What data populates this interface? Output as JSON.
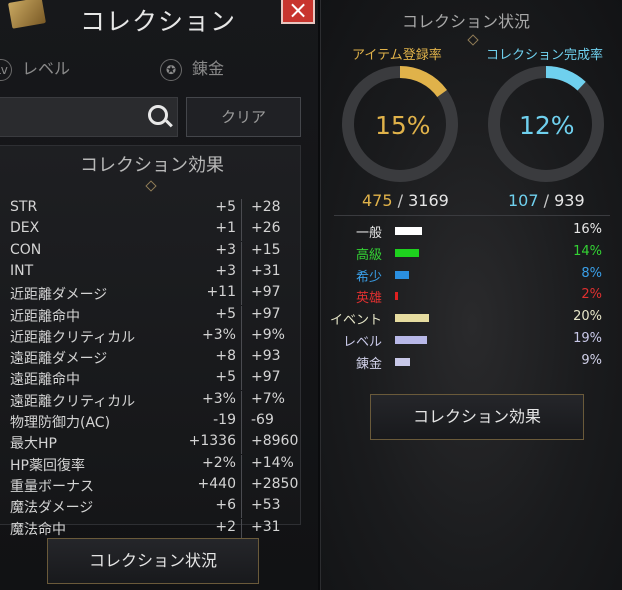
{
  "left_panel": {
    "title": "コレクション",
    "close_glyph": "×",
    "tabs": [
      {
        "label": "レベル",
        "icon": "level-icon",
        "icon_glyph": "Lv"
      },
      {
        "label": "錬金",
        "icon": "pentagram-icon",
        "icon_glyph": "✪"
      }
    ],
    "search": {
      "value": "",
      "placeholder": ""
    },
    "clear_label": "クリア",
    "effects_title": "コレクション効果",
    "stats": [
      {
        "name": "STR",
        "a": "+5",
        "b": "+28"
      },
      {
        "name": "DEX",
        "a": "+1",
        "b": "+26"
      },
      {
        "name": "CON",
        "a": "+3",
        "b": "+15"
      },
      {
        "name": "INT",
        "a": "+3",
        "b": "+31"
      },
      {
        "name": "近距離ダメージ",
        "a": "+11",
        "b": "+97"
      },
      {
        "name": "近距離命中",
        "a": "+5",
        "b": "+97"
      },
      {
        "name": "近距離クリティカル",
        "a": "+3%",
        "b": "+9%"
      },
      {
        "name": "遠距離ダメージ",
        "a": "+8",
        "b": "+93"
      },
      {
        "name": "遠距離命中",
        "a": "+5",
        "b": "+97"
      },
      {
        "name": "遠距離クリティカル",
        "a": "+3%",
        "b": "+7%"
      },
      {
        "name": "物理防御力(AC)",
        "a": "-19",
        "b": "-69"
      },
      {
        "name": "最大HP",
        "a": "+1336",
        "b": "+8960"
      },
      {
        "name": "HP薬回復率",
        "a": "+2%",
        "b": "+14%"
      },
      {
        "name": "重量ボーナス",
        "a": "+440",
        "b": "+2850"
      },
      {
        "name": "魔法ダメージ",
        "a": "+6",
        "b": "+53"
      },
      {
        "name": "魔法命中",
        "a": "+2",
        "b": "+31"
      }
    ],
    "status_button": "コレクション状況"
  },
  "right_panel": {
    "title": "コレクション状況",
    "gauges": [
      {
        "label": "アイテム登録率",
        "percent_text": "15%",
        "value": 0.15,
        "color": "#e0b24a",
        "count_current": "475",
        "count_total": "3169"
      },
      {
        "label": "コレクション完成率",
        "percent_text": "12%",
        "value": 0.12,
        "color": "#6fd0ee",
        "count_current": "107",
        "count_total": "939"
      }
    ],
    "count_sep": "/",
    "rarity": [
      {
        "name": "一般",
        "pct": "16%",
        "value": 0.16,
        "color": "#ffffff",
        "text_color": "#e6e6e6"
      },
      {
        "name": "高級",
        "pct": "14%",
        "value": 0.14,
        "color": "#1ed21e",
        "text_color": "#34d234"
      },
      {
        "name": "希少",
        "pct": "8%",
        "value": 0.08,
        "color": "#2a8fe0",
        "text_color": "#3a9fe8"
      },
      {
        "name": "英雄",
        "pct": "2%",
        "value": 0.02,
        "color": "#e02020",
        "text_color": "#e03030"
      },
      {
        "name": "イベント",
        "pct": "20%",
        "value": 0.2,
        "color": "#e6dca0",
        "text_color": "#e6e6c8"
      },
      {
        "name": "レベル",
        "pct": "19%",
        "value": 0.19,
        "color": "#b8b8e8",
        "text_color": "#c8c8e8"
      },
      {
        "name": "錬金",
        "pct": "9%",
        "value": 0.09,
        "color": "#c8c8e8",
        "text_color": "#d0d0e8"
      }
    ],
    "effects_button": "コレクション効果"
  }
}
